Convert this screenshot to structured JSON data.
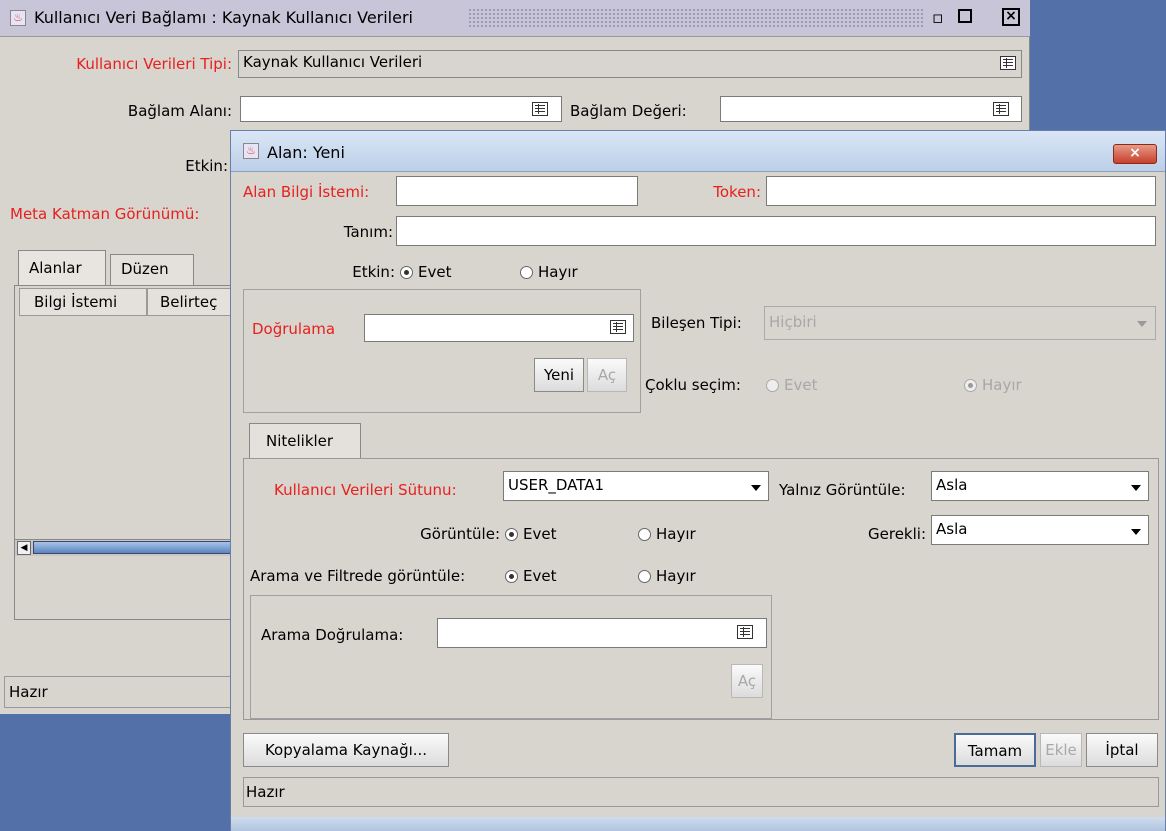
{
  "back_window": {
    "title": "Kullanıcı Veri Bağlamı : Kaynak Kullanıcı Verileri",
    "user_data_type_label": "Kullanıcı Verileri Tipi:",
    "user_data_type_value": "Kaynak Kullanıcı Verileri",
    "context_field_label": "Bağlam Alanı:",
    "context_value_label": "Bağlam Değeri:",
    "enabled_label": "Etkin:",
    "meta_layer_label": "Meta Katman Görünümü:",
    "tabs": [
      "Alanlar",
      "Düzen"
    ],
    "columns": [
      "Bilgi İstemi",
      "Belirteç"
    ],
    "status": "Hazır"
  },
  "dialog": {
    "title": "Alan: Yeni",
    "field_prompt_label": "Alan Bilgi İstemi:",
    "field_prompt_value": "",
    "token_label": "Token:",
    "token_value": "",
    "description_label": "Tanım:",
    "description_value": "",
    "enabled_label": "Etkin:",
    "yes": "Evet",
    "no": "Hayır",
    "validation_label": "Doğrulama",
    "validation_value": "",
    "new_button": "Yeni",
    "open_button": "Aç",
    "component_type_label": "Bileşen Tipi:",
    "component_type_value": "Hiçbiri",
    "multi_select_label": "Çoklu seçim:",
    "tab_attributes": "Nitelikler",
    "user_data_column_label": "Kullanıcı Verileri Sütunu:",
    "user_data_column_value": "USER_DATA1",
    "display_only_label": "Yalnız Görüntüle:",
    "display_only_value": "Asla",
    "display_label": "Görüntüle:",
    "required_label": "Gerekli:",
    "required_value": "Asla",
    "search_filter_display_label": "Arama ve Filtrede görüntüle:",
    "search_validation_label": "Arama Doğrulama:",
    "search_validation_value": "",
    "search_open_button": "Aç",
    "copy_from_button": "Kopyalama Kaynağı...",
    "ok_button": "Tamam",
    "add_button": "Ekle",
    "cancel_button": "İptal",
    "status": "Hazır"
  },
  "colors": {
    "required_label": "#e8201e",
    "background": "#5470a8",
    "panel": "#d8d4ce"
  }
}
